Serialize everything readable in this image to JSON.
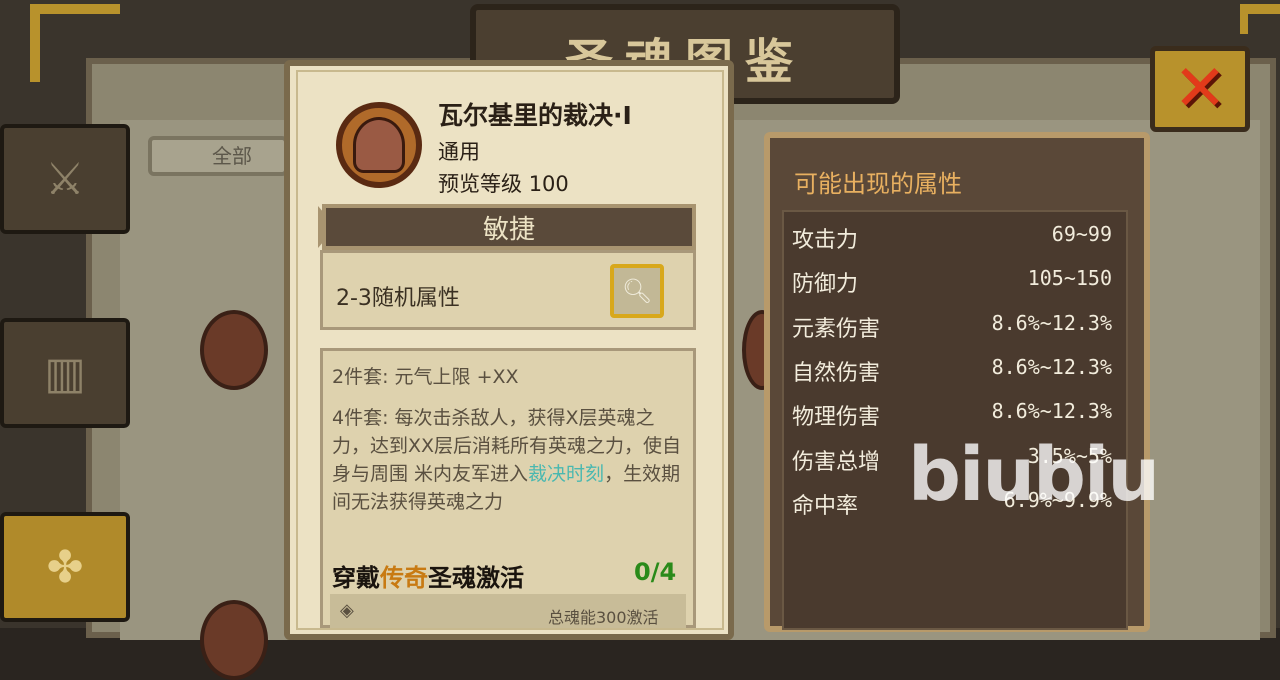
{
  "header": {
    "title": "圣魂图鉴"
  },
  "filter": {
    "label": "全部"
  },
  "item": {
    "name": "瓦尔基里的裁决·I",
    "type": "通用",
    "level_label": "预览等级",
    "level_value": "100",
    "main_stat": "敏捷",
    "random_attr": "2-3随机属性"
  },
  "set_bonus": {
    "two_piece": "2件套: 元气上限 +XX",
    "four_piece_pre": "4件套: 每次击杀敌人，获得X层英魂之力，达到XX层后消耗所有英魂之力，使自身与周围 米内友军进入",
    "four_piece_highlight": "裁决时刻",
    "four_piece_post": "，生效期间无法获得英魂之力"
  },
  "activation": {
    "prefix": "穿戴",
    "legend": "传奇",
    "suffix": "圣魂激活",
    "progress": "0/4"
  },
  "footer": {
    "text": "总魂能300激活"
  },
  "attributes": {
    "title": "可能出现的属性",
    "rows": [
      {
        "name": "攻击力",
        "value": "69~99"
      },
      {
        "name": "防御力",
        "value": "105~150"
      },
      {
        "name": "元素伤害",
        "value": "8.6%~12.3%"
      },
      {
        "name": "自然伤害",
        "value": "8.6%~12.3%"
      },
      {
        "name": "物理伤害",
        "value": "8.6%~12.3%"
      },
      {
        "name": "伤害总增",
        "value": "3.5%~5%"
      },
      {
        "name": "命中率",
        "value": "6.9%~9.9%"
      }
    ]
  },
  "watermark": "biubiu",
  "icons": {
    "close": "close-x-icon",
    "zoom": "magnifier-icon",
    "sword_tab": "sword-icon",
    "armor_tab": "armor-icon",
    "grid_tab": "grid-icon"
  },
  "colors": {
    "legend": "#c87a12",
    "highlight": "#4ab8b0",
    "progress": "#2a8a1a",
    "close": "#e23a1a"
  }
}
